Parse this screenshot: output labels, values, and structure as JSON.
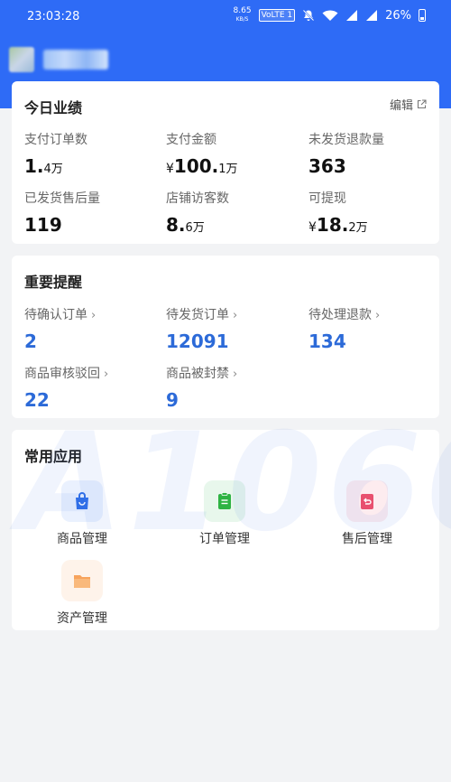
{
  "status_bar": {
    "time": "23:03:28",
    "net_speed_value": "8.65",
    "net_speed_unit": "KB/S",
    "volte": "VoLTE 1",
    "battery": "26%"
  },
  "performance": {
    "title": "今日业绩",
    "edit_label": "编辑",
    "metrics": [
      {
        "label": "支付订单数",
        "main": "1.",
        "small": "4万",
        "prefix": ""
      },
      {
        "label": "支付金额",
        "main": "100.",
        "small": "1万",
        "prefix": "¥"
      },
      {
        "label": "未发货退款量",
        "main": "363",
        "small": "",
        "prefix": ""
      },
      {
        "label": "已发货售后量",
        "main": "119",
        "small": "",
        "prefix": ""
      },
      {
        "label": "店铺访客数",
        "main": "8.",
        "small": "6万",
        "prefix": ""
      },
      {
        "label": "可提现",
        "main": "18.",
        "small": "2万",
        "prefix": "¥"
      }
    ]
  },
  "reminders": {
    "title": "重要提醒",
    "items": [
      {
        "label": "待确认订单",
        "value": "2"
      },
      {
        "label": "待发货订单",
        "value": "12091"
      },
      {
        "label": "待处理退款",
        "value": "134"
      },
      {
        "label": "商品审核驳回",
        "value": "22"
      },
      {
        "label": "商品被封禁",
        "value": "9"
      }
    ]
  },
  "apps": {
    "title": "常用应用",
    "items": [
      {
        "label": "商品管理",
        "icon": "shopping-bag-icon",
        "color": "#2f6fe8"
      },
      {
        "label": "订单管理",
        "icon": "clipboard-icon",
        "color": "#2fb344"
      },
      {
        "label": "售后管理",
        "icon": "return-icon",
        "color": "#e8506e"
      },
      {
        "label": "资产管理",
        "icon": "folder-icon",
        "color": "#f7a35c"
      }
    ]
  },
  "watermark": "A1060",
  "colors": {
    "brand": "#2e6bf6",
    "value_blue": "#2c6ad8"
  }
}
